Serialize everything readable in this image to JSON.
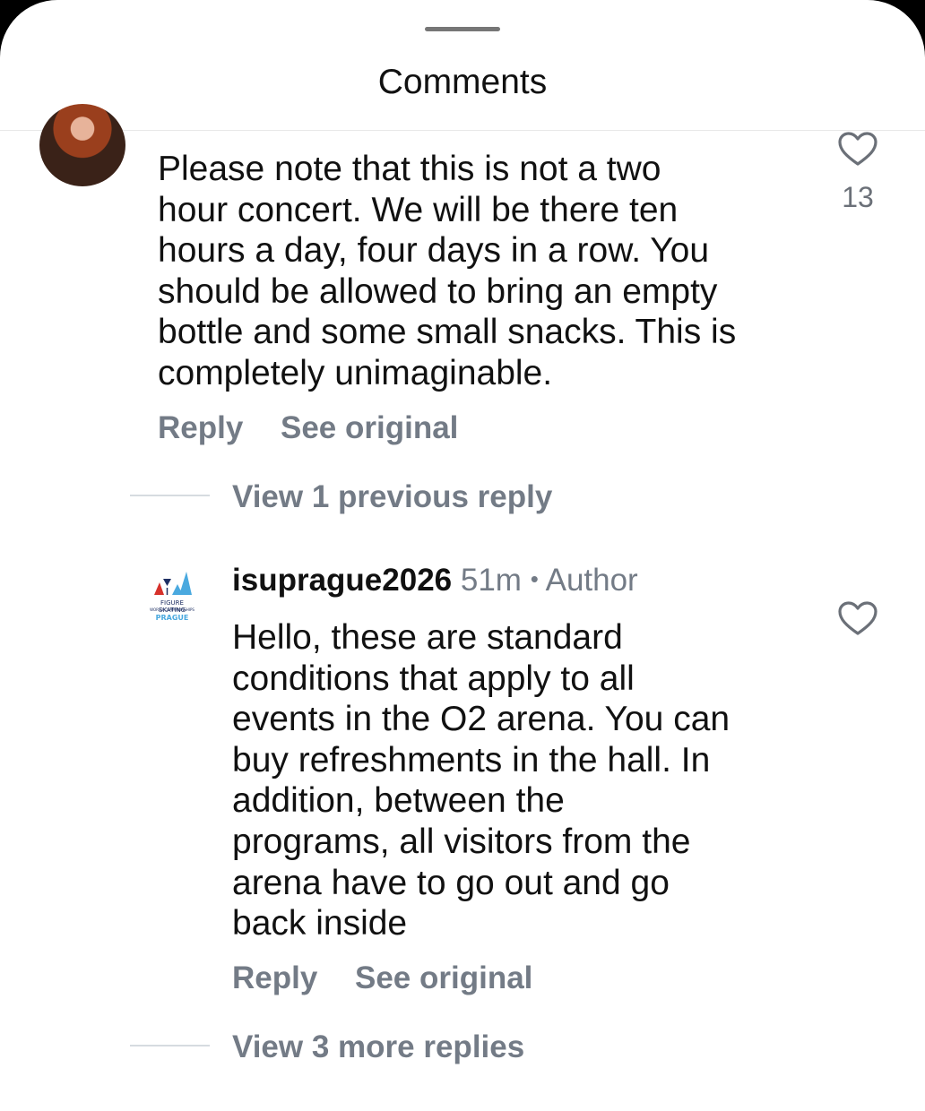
{
  "header": {
    "title": "Comments"
  },
  "comments": [
    {
      "text": "Please note that this is not a two\nhour concert. We will be there ten\nhours a day, four days in a row. You\nshould be allowed to bring an empty\nbottle and some small snacks. This is\ncompletely unimaginable.",
      "likes": "13",
      "reply_label": "Reply",
      "see_original_label": "See original",
      "thread_link": "View 1 previous reply"
    },
    {
      "username": "isuprague2026",
      "time": "51m",
      "separator": "•",
      "author_badge": "Author",
      "text": "Hello, these are standard\nconditions that apply to all\nevents in the O2 arena. You can\nbuy refreshments in the hall. In\naddition, between the\nprograms, all visitors from the\narena have to go out and go\nback inside",
      "reply_label": "Reply",
      "see_original_label": "See original",
      "thread_link": "View 3 more replies",
      "logo": {
        "line1": "FIGURE SKATING",
        "line2": "WORLD CHAMPIONSHIPS",
        "line3": "PRAGUE"
      }
    }
  ],
  "icons": {
    "like": "heart-outline-icon"
  },
  "colors": {
    "primary_text": "#111111",
    "secondary_text": "#737b86",
    "logo_red": "#d6312b",
    "logo_blue": "#1e2f63",
    "logo_cyan": "#4aa9df"
  }
}
